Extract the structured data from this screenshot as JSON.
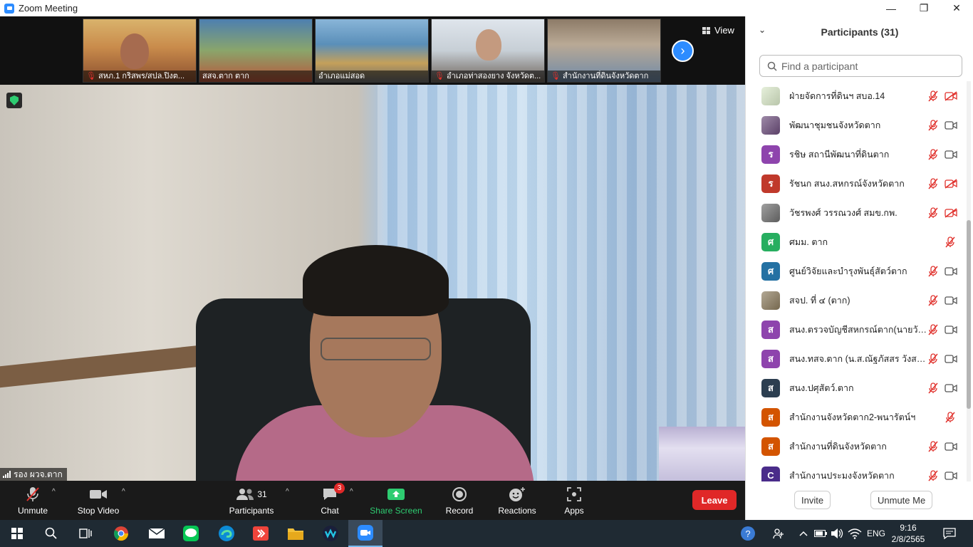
{
  "window": {
    "title": "Zoom Meeting",
    "controls": {
      "minimize": "—",
      "restore": "❐",
      "close": "✕"
    }
  },
  "gallery": {
    "view_label": "View",
    "tiles": [
      {
        "label": "สหภ.1 กริสพร/สปล.ปิงต...",
        "muted": true
      },
      {
        "label": "สสจ.ตาก ตาก",
        "muted": false
      },
      {
        "label": "อำเภอแม่สอด",
        "muted": false
      },
      {
        "label": "อำเภอท่าสองยาง จังหวัดต...",
        "muted": true
      },
      {
        "label": "สำนักงานที่ดินจังหวัดตาก",
        "muted": true
      }
    ],
    "next_icon": "chevron-right-icon"
  },
  "speaker": {
    "name": "รอง ผวจ.ตาก"
  },
  "toolbar": {
    "unmute": "Unmute",
    "stop_video": "Stop Video",
    "participants": "Participants",
    "participants_count": "31",
    "chat": "Chat",
    "chat_badge": "3",
    "share_screen": "Share Screen",
    "record": "Record",
    "reactions": "Reactions",
    "apps": "Apps",
    "leave": "Leave"
  },
  "panel": {
    "title": "Participants (31)",
    "search_placeholder": "Find a participant",
    "participants": [
      {
        "name": "ฝ่ายจัดการที่ดินฯ สบอ.14",
        "avatar": "img",
        "color": "#d9e8c8",
        "video_off": true
      },
      {
        "name": "พัฒนาชุมชนจังหวัดตาก",
        "avatar": "img",
        "color": "#6b4c7a",
        "video_off": false
      },
      {
        "name": "รชิษ สถานีพัฒนาที่ดินตาก",
        "avatar": "ร",
        "color": "#8e44ad",
        "video_off": false
      },
      {
        "name": "รัชนก สนง.สหกรณ์จังหวัดตาก",
        "avatar": "ร",
        "color": "#c0392b",
        "video_off": true
      },
      {
        "name": "วัชรพงศ์ วรรณวงศ์ สมข.กพ.",
        "avatar": "img",
        "color": "#6d6d6d",
        "video_off": true
      },
      {
        "name": "ศมม. ตาก",
        "avatar": "ศ",
        "color": "#27ae60",
        "video_off": null
      },
      {
        "name": "ศูนย์วิจัยและบำรุงพันธุ์สัตว์ตาก",
        "avatar": "ศ",
        "color": "#2471a3",
        "video_off": false
      },
      {
        "name": "สจป. ที่ ๔ (ตาก)",
        "avatar": "img",
        "color": "#8a7a5c",
        "video_off": false
      },
      {
        "name": "สนง.ตรวจบัญชีสหกรณ์ตาก(นายวันชั...",
        "avatar": "ส",
        "color": "#8e44ad",
        "video_off": false
      },
      {
        "name": "สนง.ทสจ.ตาก (น.ส.ณัฐภัสสร วังสาร ...",
        "avatar": "ส",
        "color": "#8e44ad",
        "video_off": false
      },
      {
        "name": "สนง.ปศุสัตว์.ตาก",
        "avatar": "ส",
        "color": "#2c3e50",
        "video_off": false
      },
      {
        "name": "สำนักงานจังหวัดตาก2-พนารัตน์ฯ",
        "avatar": "ส",
        "color": "#d35400",
        "video_off": null
      },
      {
        "name": "สำนักงานที่ดินจังหวัดตาก",
        "avatar": "ส",
        "color": "#d35400",
        "video_off": false
      },
      {
        "name": "สำนักงานประมงจังหวัดตาก",
        "avatar": "C",
        "color": "#4a2c8a",
        "video_off": false
      }
    ],
    "invite": "Invite",
    "unmute_me": "Unmute Me"
  },
  "taskbar": {
    "language": "ENG",
    "time": "9:16",
    "date": "2/8/2565"
  },
  "colors": {
    "accent": "#2d8cff",
    "leave": "#e02828",
    "muted_red": "#e0312c",
    "share_green": "#2ecc71",
    "taskbar": "#1f2a33"
  }
}
